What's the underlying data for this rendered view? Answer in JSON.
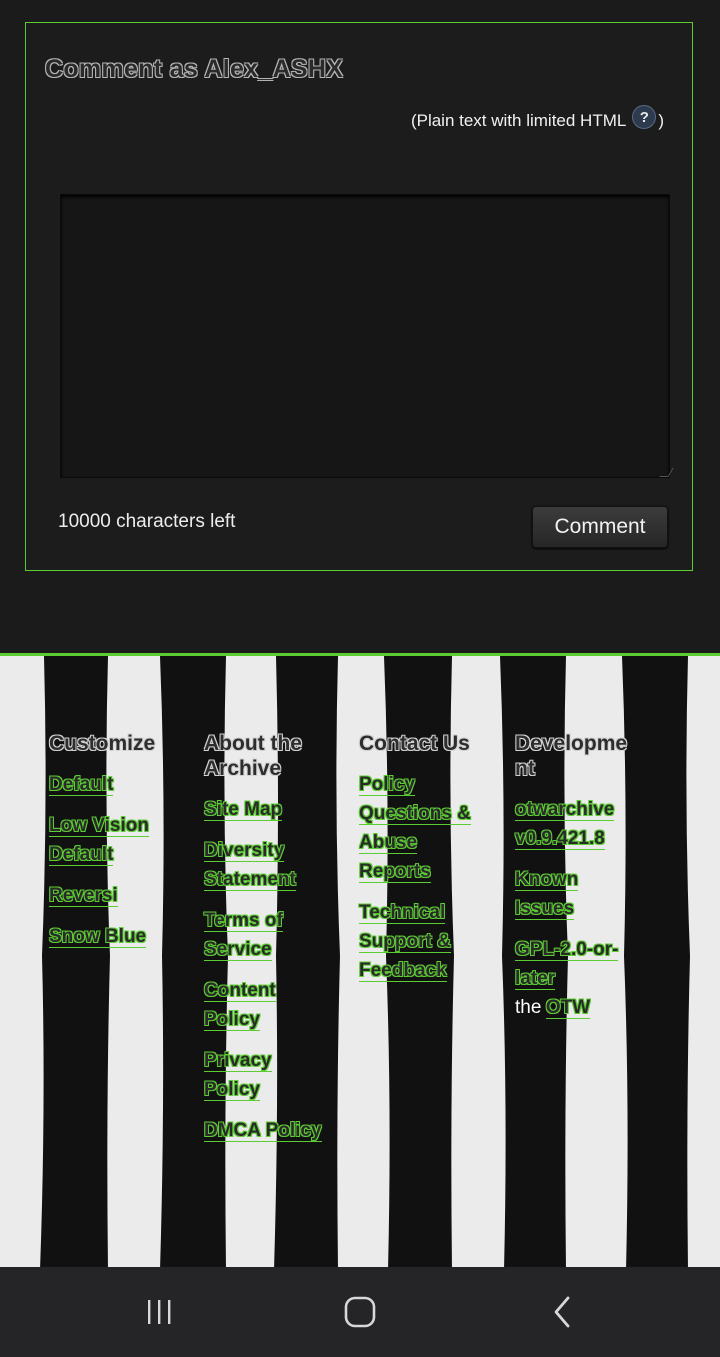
{
  "comment_form": {
    "heading": "Comment as Alex_ASHX",
    "format_note_prefix": "(Plain text with limited HTML",
    "help_icon_label": "?",
    "format_note_suffix": ")",
    "textarea_value": "",
    "chars_left": "10000 characters left",
    "submit_label": "Comment"
  },
  "footer": {
    "customize": {
      "heading": "Customize",
      "links": [
        "Default",
        "Low Vision Default",
        "Reversi",
        "Snow Blue"
      ]
    },
    "about": {
      "heading": "About the Archive",
      "links": [
        "Site Map",
        "Diversity Statement",
        "Terms of Service",
        "Content Policy",
        "Privacy Policy",
        "DMCA Policy"
      ]
    },
    "contact": {
      "heading": "Contact Us",
      "links": [
        "Policy Questions & Abuse Reports",
        "Technical Support & Feedback"
      ]
    },
    "development": {
      "heading": "Developme nt",
      "links": [
        "otwarchive v0.9.421.8",
        "Known Issues",
        "GPL-2.0-or-later"
      ],
      "the_prefix": "the",
      "otw_link": "OTW"
    }
  },
  "nav_bar": {
    "recent_icon": "recent-apps-icon",
    "home_icon": "home-icon",
    "back_icon": "back-icon"
  },
  "colors": {
    "accent": "#5ccc33",
    "background": "#1b1b1b",
    "nav_bar": "#252426"
  }
}
